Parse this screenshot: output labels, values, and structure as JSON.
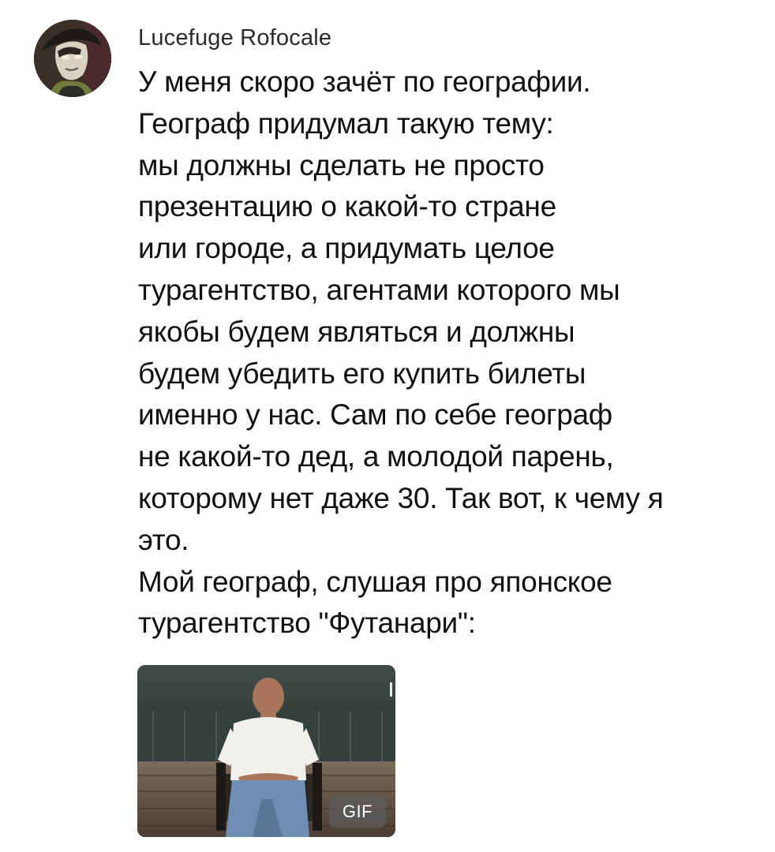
{
  "comment": {
    "author": {
      "name": "Lucefuge Rofocale",
      "avatar_icon": "anime-character-avatar"
    },
    "lines": [
      "У меня скоро зачёт по географии.",
      "Географ придумал такую тему:",
      "мы должны сделать не просто",
      "презентацию о какой-то стране",
      "или городе, а придумать целое",
      "турагентство, агентами которого мы",
      "якобы будем являться и должны",
      "будем убедить его купить билеты",
      "именно у нас. Сам по себе географ",
      "не какой-то дед, а молодой парень,",
      "которому нет даже 30. Так вот, к чему я",
      "это.",
      "Мой географ, слушая про японское",
      "турагентство \"Футанари\":"
    ],
    "attachment": {
      "type_badge": "GIF",
      "preview_icon": "man-sitting-on-chair-gif-preview"
    }
  }
}
